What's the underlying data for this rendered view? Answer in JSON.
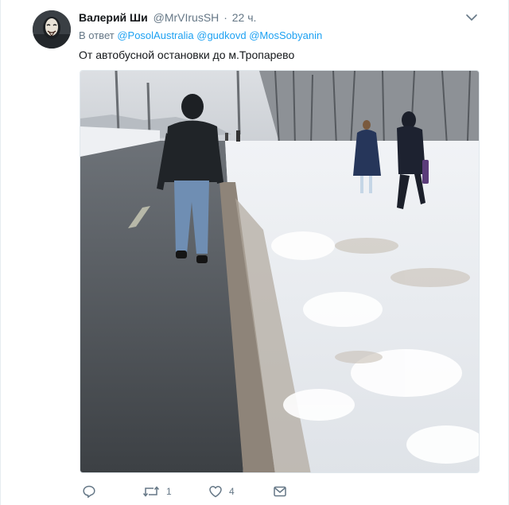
{
  "tweet": {
    "author_name": "Валерий Ши",
    "author_handle": "@MrVIrusSH",
    "separator": "·",
    "timestamp": "22 ч.",
    "reply_prefix": "В ответ",
    "mentions": [
      "@PosolAustralia",
      "@gudkovd",
      "@MosSobyanin"
    ],
    "text": "От автобусной остановки до м.Тропарево"
  },
  "actions": {
    "reply_icon": "comment-bubble-icon",
    "retweet_icon": "retweet-icon",
    "retweet_count": "1",
    "like_icon": "heart-icon",
    "like_count": "4",
    "dm_icon": "envelope-icon"
  },
  "colors": {
    "link": "#1da1f2",
    "secondary_text": "#657786",
    "primary_text": "#14171a"
  }
}
